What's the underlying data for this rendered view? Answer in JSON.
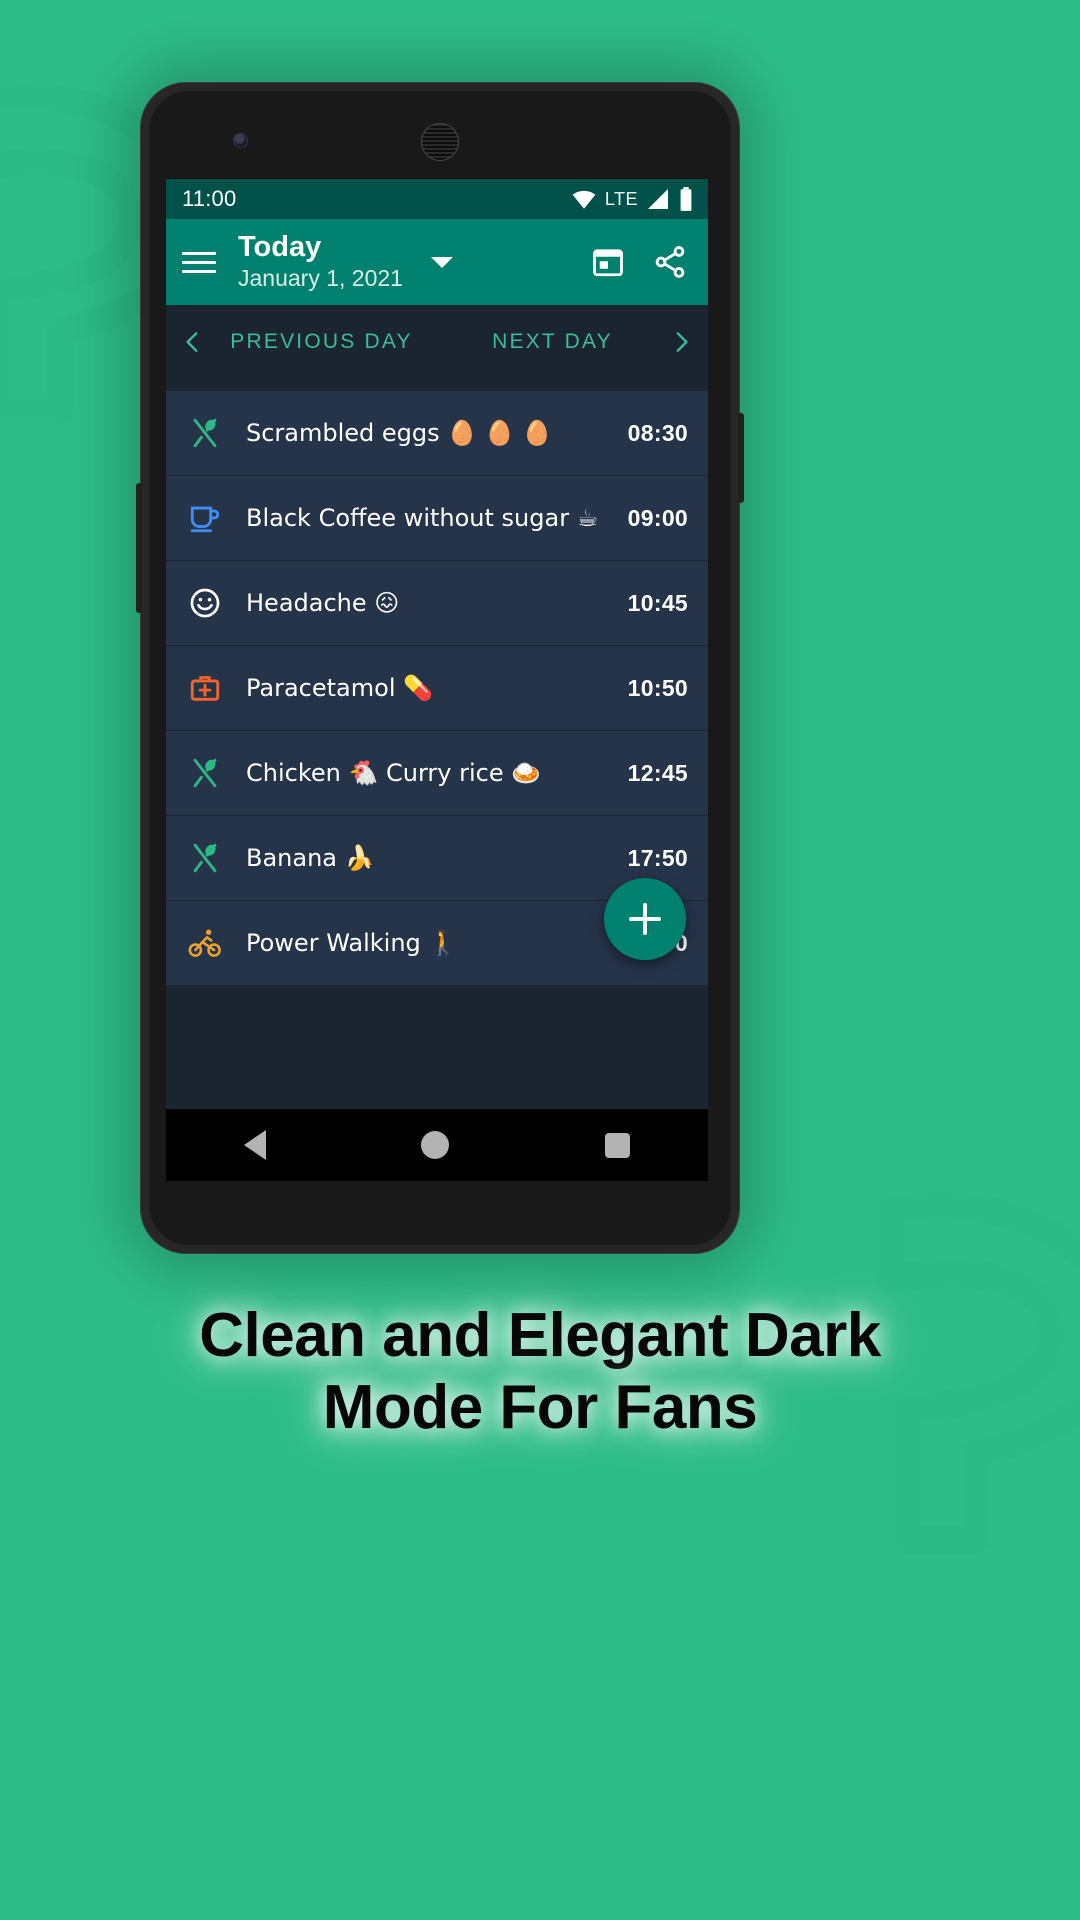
{
  "background": {
    "color": "#2ebd8a"
  },
  "status_bar": {
    "time": "11:00",
    "network_label": "LTE",
    "icons": [
      "wifi-icon",
      "signal-icon",
      "battery-icon"
    ],
    "bg_color": "#00514a"
  },
  "app_bar": {
    "menu_icon": "hamburger-menu-icon",
    "title": "Today",
    "subtitle": "January 1, 2021",
    "dropdown_icon": "chevron-down-icon",
    "calendar_icon": "calendar-icon",
    "share_icon": "share-icon",
    "bg_color": "#00806f"
  },
  "day_nav": {
    "previous_label": "PREVIOUS DAY",
    "next_label": "NEXT DAY",
    "prev_icon": "chevron-left-icon",
    "next_icon": "chevron-right-icon",
    "accent_color": "#3bbd96"
  },
  "entries": [
    {
      "icon": "fork-spoon-icon",
      "icon_color": "#2eb887",
      "text": "Scrambled eggs 🥚 🥚 🥚",
      "time": "08:30"
    },
    {
      "icon": "coffee-cup-icon",
      "icon_color": "#3f8ef7",
      "text": "Black Coffee without sugar ☕",
      "time": "09:00"
    },
    {
      "icon": "smiley-face-icon",
      "icon_color": "#ffffff",
      "text": "Headache 😖",
      "time": "10:45"
    },
    {
      "icon": "medical-kit-icon",
      "icon_color": "#f4652b",
      "text": "Paracetamol 💊",
      "time": "10:50"
    },
    {
      "icon": "fork-spoon-icon",
      "icon_color": "#2eb887",
      "text": "Chicken 🐔 Curry rice 🍛",
      "time": "12:45"
    },
    {
      "icon": "fork-spoon-icon",
      "icon_color": "#2eb887",
      "text": "Banana 🍌",
      "time": "17:50"
    },
    {
      "icon": "bicycle-icon",
      "icon_color": "#eda22e",
      "text": "Power Walking 🚶",
      "time": "19:00"
    }
  ],
  "fab": {
    "icon": "plus-icon",
    "color": "#00806f"
  },
  "nav_bar": {
    "back_icon": "back-triangle-icon",
    "home_icon": "home-circle-icon",
    "recents_icon": "recents-square-icon"
  },
  "caption": {
    "line1": "Clean and Elegant Dark",
    "line2": "Mode For Fans"
  }
}
